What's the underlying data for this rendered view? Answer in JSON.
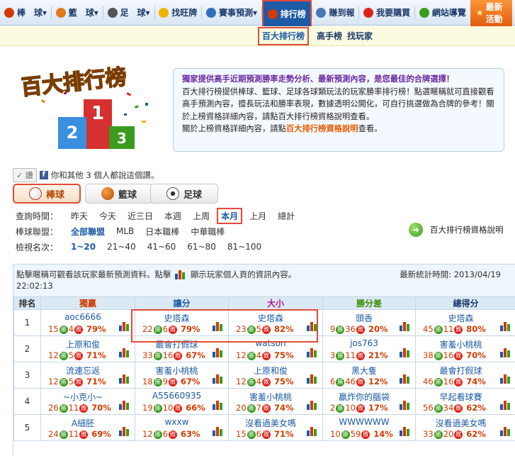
{
  "nav": {
    "items": [
      {
        "label": "棒　球",
        "icon": "baseball-icon",
        "color": "#d13b00"
      },
      {
        "label": "籃　球",
        "icon": "basketball-icon",
        "color": "#e07a1a"
      },
      {
        "label": "足　球",
        "icon": "soccer-icon",
        "color": "#555555"
      },
      {
        "label": "找旺牌",
        "icon": "lightbulb-icon",
        "color": "#f0b400"
      },
      {
        "label": "賽事預測",
        "icon": "envelope-icon",
        "color": "#2f6fc0"
      },
      {
        "label": "排行榜",
        "icon": "bar-chart-icon",
        "color": "#d13b00"
      },
      {
        "label": "賺到報",
        "icon": "newspaper-icon",
        "color": "#4a78b5"
      },
      {
        "label": "我要購買",
        "icon": "dollar-icon",
        "color": "#e0231a"
      },
      {
        "label": "網站導覽",
        "icon": "sitemap-icon",
        "color": "#3a9b1f"
      }
    ],
    "dropdown_arrow": "▾",
    "cta": "最新活動"
  },
  "subnav": {
    "items": [
      "百大排行榜",
      "高手榜",
      "找玩家"
    ]
  },
  "banner": {
    "logo_text": "百大排行榜",
    "lead": "獨家提供高手近期預測勝率走勢分析、最新預測內容，是您最佳的合牌選擇！",
    "body": "百大排行榜提供棒球、籃球、足球各球類玩法的玩家勝率排行榜！點選暱稱就可直接觀看高手預測內容，擅長玩法和勝率表現，數據透明公開化，可自行挑選做為合牌的參考！關於上榜資格詳細內容，請點百大排行榜資格說明查看。",
    "tail_before": "關於上榜資格詳細內容，請點",
    "tail_link": "百大排行榜資格說明",
    "tail_after": "查看。"
  },
  "like": {
    "button": "讚",
    "text": "你和其他 3 個人都說這個讚。"
  },
  "sports": {
    "tabs": [
      "棒球",
      "籃球",
      "足球"
    ],
    "active": "棒球"
  },
  "filters": {
    "time_label": "查詢時間：",
    "time_opts": [
      "昨天",
      "今天",
      "近三日",
      "本週",
      "上周",
      "本月",
      "上月",
      "總計"
    ],
    "league_label": "棒球聯盟：",
    "league_opts": [
      "全部聯盟",
      "MLB",
      "日本職棒",
      "中華職棒"
    ],
    "rank_label": "檢視名次：",
    "rank_opts": [
      "1~20",
      "21~40",
      "41~60",
      "61~80",
      "81~100"
    ],
    "qualify_link": "百大排行榜資格說明"
  },
  "ranking": {
    "note_a": "點擊暱稱可觀看該玩家最新預測資料。點擊",
    "note_b": "顯示玩家個人頁的資訊內容。",
    "updated": "最新統計時間: 2013/04/19",
    "time": "22:02:13",
    "columns": [
      "排名",
      "獨贏",
      "讓分",
      "大小",
      "勝分差",
      "總得分"
    ],
    "win_badge": "勝",
    "loss_badge": "敗",
    "rows": [
      {
        "rank": "1",
        "cells": [
          {
            "name": "aoc6666",
            "w": "15",
            "l": "4",
            "pct": "79%"
          },
          {
            "name": "史塔森",
            "w": "22",
            "l": "6",
            "pct": "79%"
          },
          {
            "name": "史塔森",
            "w": "23",
            "l": "5",
            "pct": "82%"
          },
          {
            "name": "頭香",
            "w": "9",
            "l": "36",
            "pct": "20%"
          },
          {
            "name": "史塔森",
            "w": "45",
            "l": "11",
            "pct": "80%"
          }
        ]
      },
      {
        "rank": "2",
        "cells": [
          {
            "name": "上原和俊",
            "w": "12",
            "l": "5",
            "pct": "71%"
          },
          {
            "name": "最會打假球",
            "w": "33",
            "l": "16",
            "pct": "67%"
          },
          {
            "name": "watson",
            "w": "12",
            "l": "4",
            "pct": "75%"
          },
          {
            "name": "jos763",
            "w": "3",
            "l": "11",
            "pct": "21%"
          },
          {
            "name": "害羞小桃桃",
            "w": "38",
            "l": "16",
            "pct": "70%"
          }
        ]
      },
      {
        "rank": "3",
        "cells": [
          {
            "name": "流連忘返",
            "w": "12",
            "l": "5",
            "pct": "71%"
          },
          {
            "name": "害羞小桃桃",
            "w": "18",
            "l": "9",
            "pct": "67%"
          },
          {
            "name": "上原和俊",
            "w": "12",
            "l": "4",
            "pct": "75%"
          },
          {
            "name": "黑大隻",
            "w": "6",
            "l": "46",
            "pct": "12%"
          },
          {
            "name": "最會打假球",
            "w": "46",
            "l": "16",
            "pct": "74%"
          }
        ]
      },
      {
        "rank": "4",
        "cells": [
          {
            "name": "~小克小~",
            "w": "26",
            "l": "11",
            "pct": "70%"
          },
          {
            "name": "A55660935",
            "w": "19",
            "l": "10",
            "pct": "66%"
          },
          {
            "name": "害羞小桃桃",
            "w": "20",
            "l": "7",
            "pct": "74%"
          },
          {
            "name": "贏炸你的腦袋",
            "w": "2",
            "l": "10",
            "pct": "17%"
          },
          {
            "name": "早起看球賽",
            "w": "56",
            "l": "34",
            "pct": "62%"
          }
        ]
      },
      {
        "rank": "5",
        "cells": [
          {
            "name": "A細胚",
            "w": "24",
            "l": "11",
            "pct": "69%"
          },
          {
            "name": "wxxw",
            "w": "12",
            "l": "6",
            "pct": "63%"
          },
          {
            "name": "沒看過美女嗎",
            "w": "15",
            "l": "6",
            "pct": "71%"
          },
          {
            "name": "WWWWWW",
            "w": "10",
            "l": "59",
            "pct": "14%"
          },
          {
            "name": "沒看過美女嗎",
            "w": "33",
            "l": "20",
            "pct": "62%"
          }
        ]
      }
    ]
  },
  "colors": {
    "nav_active": "#1d5aa5",
    "highlight": "#e34a3a",
    "win": "#3a9b1f",
    "loss": "#e0231a"
  }
}
